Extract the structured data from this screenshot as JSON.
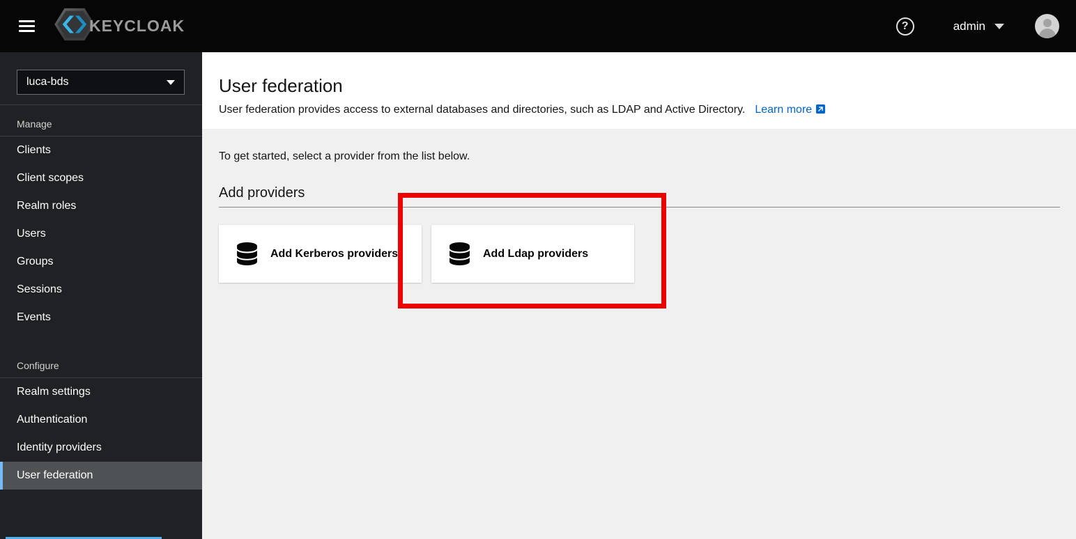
{
  "masthead": {
    "brand": "KEYCLOAK",
    "username": "admin",
    "help_glyph": "?"
  },
  "sidebar": {
    "realm_selector": {
      "value": "luca-bds"
    },
    "sections": [
      {
        "label": "Manage",
        "items": [
          {
            "label": "Clients",
            "active": false
          },
          {
            "label": "Client scopes",
            "active": false
          },
          {
            "label": "Realm roles",
            "active": false
          },
          {
            "label": "Users",
            "active": false
          },
          {
            "label": "Groups",
            "active": false
          },
          {
            "label": "Sessions",
            "active": false
          },
          {
            "label": "Events",
            "active": false
          }
        ]
      },
      {
        "label": "Configure",
        "items": [
          {
            "label": "Realm settings",
            "active": false
          },
          {
            "label": "Authentication",
            "active": false
          },
          {
            "label": "Identity providers",
            "active": false
          },
          {
            "label": "User federation",
            "active": true
          }
        ]
      }
    ]
  },
  "page": {
    "title": "User federation",
    "description": "User federation provides access to external databases and directories, such as LDAP and Active Directory.",
    "learn_more_label": "Learn more",
    "intro": "To get started, select a provider from the list below.",
    "section_heading": "Add providers",
    "providers": [
      {
        "label": "Add Kerberos providers",
        "icon": "database-icon",
        "highlighted": false
      },
      {
        "label": "Add Ldap providers",
        "icon": "database-icon",
        "highlighted": true
      }
    ]
  },
  "annotation": {
    "type": "highlight-rectangle",
    "target": "Add Ldap providers card",
    "color": "#ec0000"
  },
  "colors": {
    "masthead_bg": "#060606",
    "sidebar_bg": "#1f2124",
    "active_item_bg": "#4f5255",
    "active_item_accent": "#73bcf7",
    "content_bg": "#f0f0f0",
    "link": "#0066cc"
  }
}
